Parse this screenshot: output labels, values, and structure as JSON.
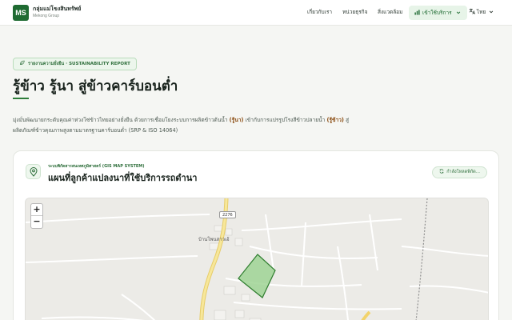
{
  "brand": {
    "logo_text": "MS",
    "name": "กลุ่มแม่โขงสินทรัพย์",
    "subname": "Mekong Group"
  },
  "nav": {
    "items": [
      "เกี่ยวกับเรา",
      "หน่วยธุรกิจ",
      "สิ่งแวดล้อม"
    ],
    "services_label": "เข้าใช้บริการ",
    "language_label": "ไทย"
  },
  "hero": {
    "badge": "รายงานความยั่งยืน · SUSTAINABILITY REPORT",
    "title": "รู้ข้าว รู้นา สู่ข้าวคาร์บอนต่ำ",
    "desc_1": "มุ่งมั่นพัฒนายกระดับคุณค่าห่วงโซ่ข้าวไทยอย่างยั่งยืน ด้วยการเชื่อมโยงระบบการผลิตข้าวต้นน้ำ ",
    "desc_hl_1": "(รู้นา)",
    "desc_2": " เข้ากับการแปรรูปโรงสีข้าวปลายน้ำ ",
    "desc_hl_2": "(รู้ข้าว)",
    "desc_3": " สู่ผลิตภัณฑ์ข้าวคุณภาพสูงตามมาตรฐานคาร์บอนต่ำ (SRP & ISO 14064)"
  },
  "map_card": {
    "kicker": "ระบบพิกัดสารสนเทศภูมิศาสตร์ (GIS MAP SYSTEM)",
    "title": "แผนที่ลูกค้าแปลงนาที่ใช้บริการรถดำนา",
    "loading_label": "กำลังโหลดพิกัด...",
    "zoom_in": "+",
    "zoom_out": "−",
    "road_number": "2276",
    "village_label": "บ้านโพนสาวเอ้"
  },
  "colors": {
    "brand_green": "#1f6b32",
    "accent_brown": "#8a4b10",
    "plot_fill": "#9fd394",
    "plot_stroke": "#2e7d2e"
  }
}
